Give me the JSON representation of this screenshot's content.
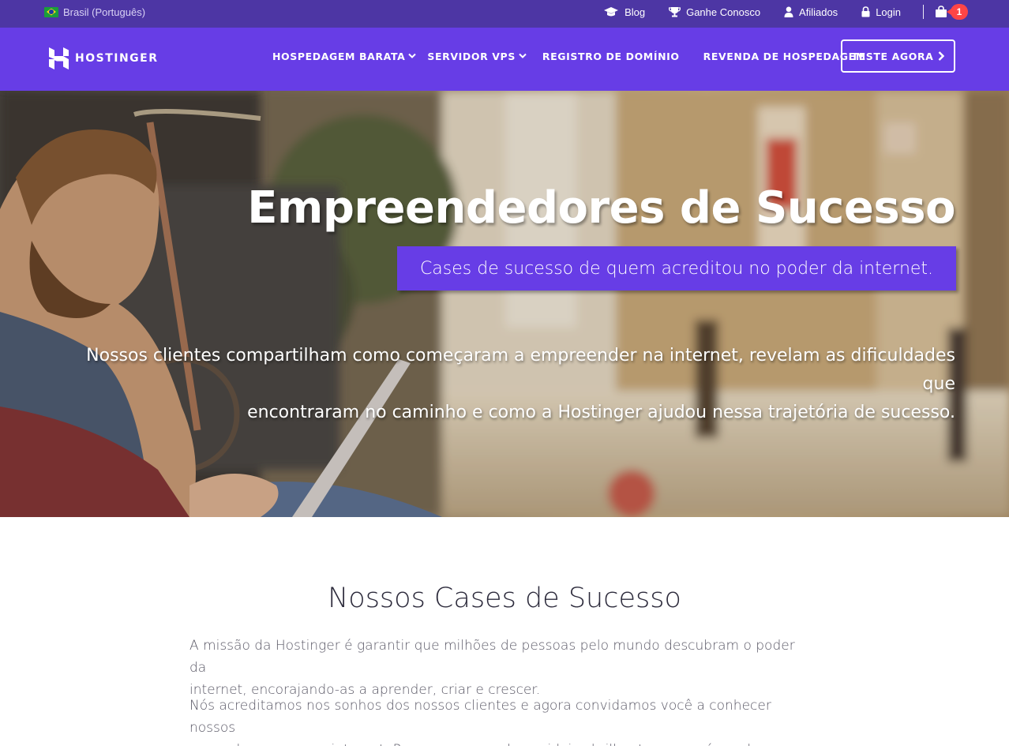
{
  "topbar": {
    "locale": "Brasil (Português)",
    "links": [
      {
        "label": "Blog",
        "icon": "graduation-cap-icon"
      },
      {
        "label": "Ganhe Conosco",
        "icon": "trophy-icon"
      },
      {
        "label": "Afiliados",
        "icon": "user-icon"
      },
      {
        "label": "Login",
        "icon": "lock-icon"
      }
    ],
    "cart_count": "1"
  },
  "nav": {
    "brand": "HOSTINGER",
    "items": [
      {
        "label": "HOSPEDAGEM BARATA",
        "has_dropdown": true
      },
      {
        "label": "SERVIDOR VPS",
        "has_dropdown": true
      },
      {
        "label": "REGISTRO DE DOMÍNIO",
        "has_dropdown": false
      },
      {
        "label": "REVENDA DE HOSPEDAGEM",
        "has_dropdown": false
      }
    ],
    "cta": "TESTE AGORA"
  },
  "hero": {
    "title": "Empreendedores de Sucesso",
    "subtitle": "Cases de sucesso de quem acreditou no poder da internet.",
    "text_line1": "Nossos clientes compartilham como começaram a empreender na internet, revelam as dificuldades que",
    "text_line2": "encontraram no caminho e como a Hostinger ajudou nessa trajetória de sucesso."
  },
  "content": {
    "title": "Nossos Cases de Sucesso",
    "p1_line1": "A missão da Hostinger é garantir que milhões de pessoas pelo mundo descubram o poder da",
    "p1_line2": "internet, encorajando-as a aprender, criar e crescer.",
    "p2_line1": "Nós acreditamos nos sonhos dos nossos clientes e agora convidamos você a conhecer nossos",
    "p2_line2": "cases de sucesso na internet. Pessoas com sonhos e ideias brilhantes que saíram da zona de"
  },
  "colors": {
    "topbar": "#4d36a4",
    "nav": "#673de6",
    "badge": "#ff4546"
  }
}
